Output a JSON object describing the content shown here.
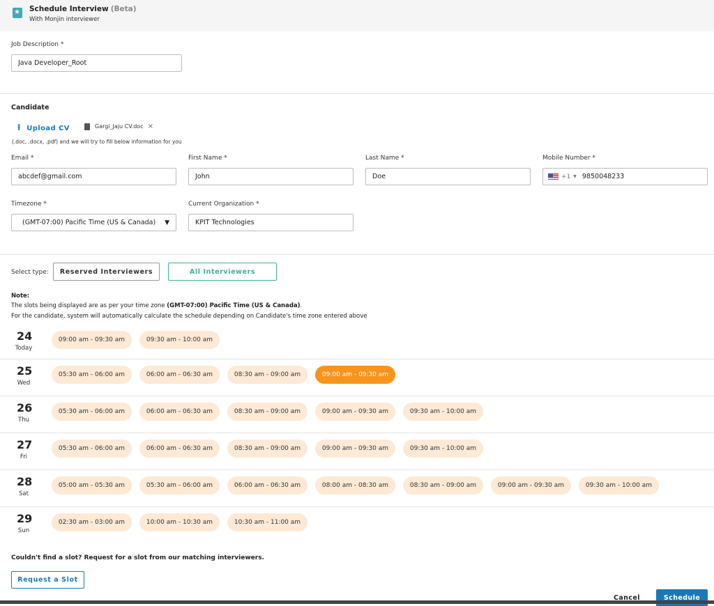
{
  "header": {
    "title": "Schedule Interview",
    "beta": "(Beta)",
    "subtitle": "With Monjin interviewer"
  },
  "job": {
    "label": "Job Description *",
    "value": "Java Developer_Root"
  },
  "candidate": {
    "section_title": "Candidate",
    "upload_label": "Upload CV",
    "file_name": "Gargi_Jaju CV.doc",
    "remove_icon": "×",
    "hint": "(.doc, .docx, .pdf) and we will try to fill below information for you",
    "email": {
      "label": "Email *",
      "value": "abcdef@gmail.com"
    },
    "first_name": {
      "label": "First Name *",
      "value": "John"
    },
    "last_name": {
      "label": "Last Name *",
      "value": "Doe"
    },
    "mobile": {
      "label": "Mobile Number *",
      "country_code": "+1",
      "value": "9850048233"
    },
    "timezone": {
      "label": "Timezone *",
      "value": "(GMT-07:00) Pacific Time (US & Canada)"
    },
    "organization": {
      "label": "Current Organization *",
      "value": "KPIT Technologies"
    }
  },
  "select_type": {
    "label": "Select type:",
    "options": [
      "Reserved Interviewers",
      "All Interviewers"
    ],
    "selected": "All Interviewers"
  },
  "note": {
    "heading": "Note:",
    "line1_prefix": "The slots being displayed are as per your time zone ",
    "line1_bold": "(GMT-07:00) Pacific Time (US & Canada)",
    "line1_suffix": ".",
    "line2": "For the candidate, system will automatically calculate the schedule depending on Candidate's time zone entered above"
  },
  "days": [
    {
      "num": "24",
      "name": "Today",
      "slots": [
        "09:00 am - 09:30 am",
        "09:30 am - 10:00 am"
      ]
    },
    {
      "num": "25",
      "name": "Wed",
      "slots": [
        "05:30 am - 06:00 am",
        "06:00 am - 06:30 am",
        "08:30 am - 09:00 am",
        "09:00 am - 09:30 am"
      ],
      "selected_index": 3
    },
    {
      "num": "26",
      "name": "Thu",
      "slots": [
        "05:30 am - 06:00 am",
        "06:00 am - 06:30 am",
        "08:30 am - 09:00 am",
        "09:00 am - 09:30 am",
        "09:30 am - 10:00 am"
      ]
    },
    {
      "num": "27",
      "name": "Fri",
      "slots": [
        "05:30 am - 06:00 am",
        "06:00 am - 06:30 am",
        "08:30 am - 09:00 am",
        "09:00 am - 09:30 am",
        "09:30 am - 10:00 am"
      ]
    },
    {
      "num": "28",
      "name": "Sat",
      "slots": [
        "05:00 am - 05:30 am",
        "05:30 am - 06:00 am",
        "06:00 am - 06:30 am",
        "08:00 am - 08:30 am",
        "08:30 am - 09:00 am",
        "09:00 am - 09:30 am",
        "09:30 am - 10:00 am"
      ]
    },
    {
      "num": "29",
      "name": "Sun",
      "slots": [
        "02:30 am - 03:00 am",
        "10:00 am - 10:30 am",
        "10:30 am - 11:00 am"
      ]
    }
  ],
  "footer": {
    "request_note": "Couldn't find a slot? Request for a slot from our matching interviewers.",
    "request_button": "Request a Slot",
    "cancel": "Cancel",
    "schedule": "Schedule"
  },
  "colors": {
    "accent_blue": "#1b78b5",
    "teal": "#3fb0a3",
    "slot_bg": "#fde9d6",
    "slot_selected": "#f7941d"
  }
}
